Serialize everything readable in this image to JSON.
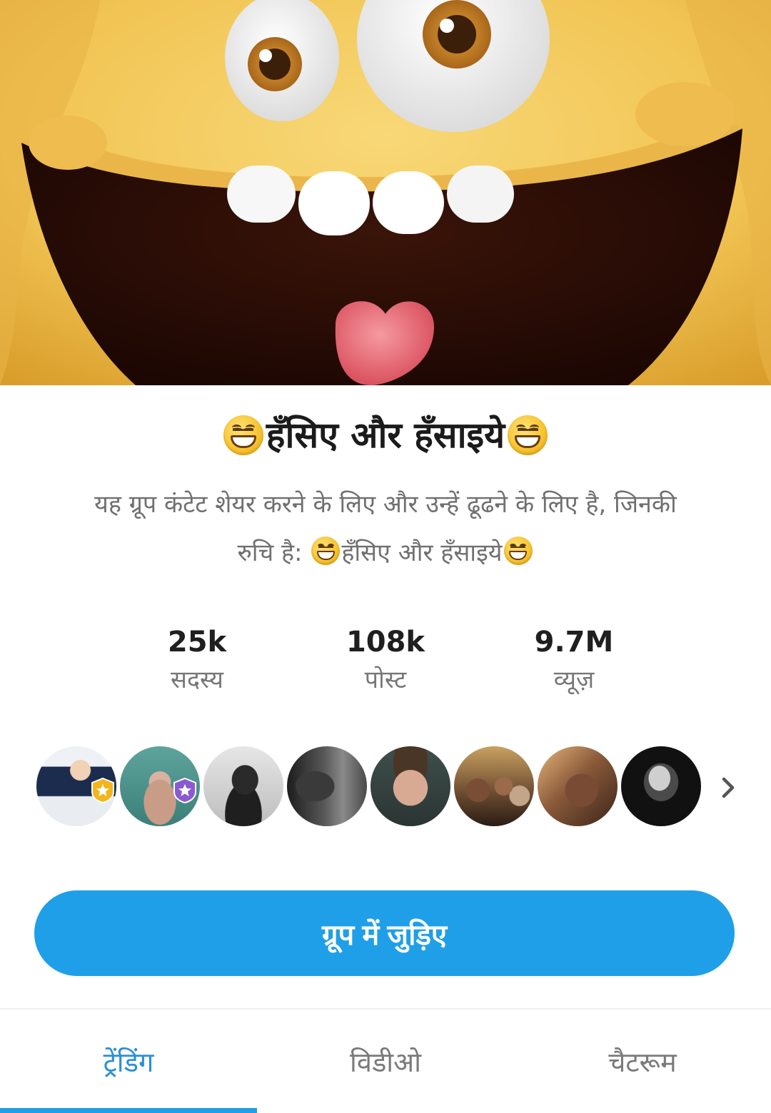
{
  "banner": {
    "image": "smiley-character-banner"
  },
  "group": {
    "title": "हँसिए और हँसाइये",
    "description_line1": "यह ग्रूप कंटेट शेयर करने के लिए और उन्हें ढूढने के लिए है, जिनकी",
    "description_line2_prefix": "रुचि है:",
    "description_line2_name": "हँसिए और हँसाइये"
  },
  "stats": [
    {
      "value": "25k",
      "label": "सदस्य"
    },
    {
      "value": "108k",
      "label": "पोस्ट"
    },
    {
      "value": "9.7M",
      "label": "व्यूज़"
    }
  ],
  "members": {
    "count_shown": 8,
    "badges": [
      "gold-star-badge",
      "purple-star-badge"
    ],
    "more_icon": "chevron-right-icon"
  },
  "join_button": {
    "label": "ग्रूप में जुड़िए"
  },
  "tabs": [
    {
      "label": "ट्रेंडिंग",
      "active": true
    },
    {
      "label": "विडीओ",
      "active": false
    },
    {
      "label": "चैटरूम",
      "active": false
    }
  ],
  "colors": {
    "accent": "#1f9fe8",
    "active_tab_text": "#2a8fd6",
    "muted_text": "#777777",
    "banner_yellow": "#f3c85d"
  }
}
